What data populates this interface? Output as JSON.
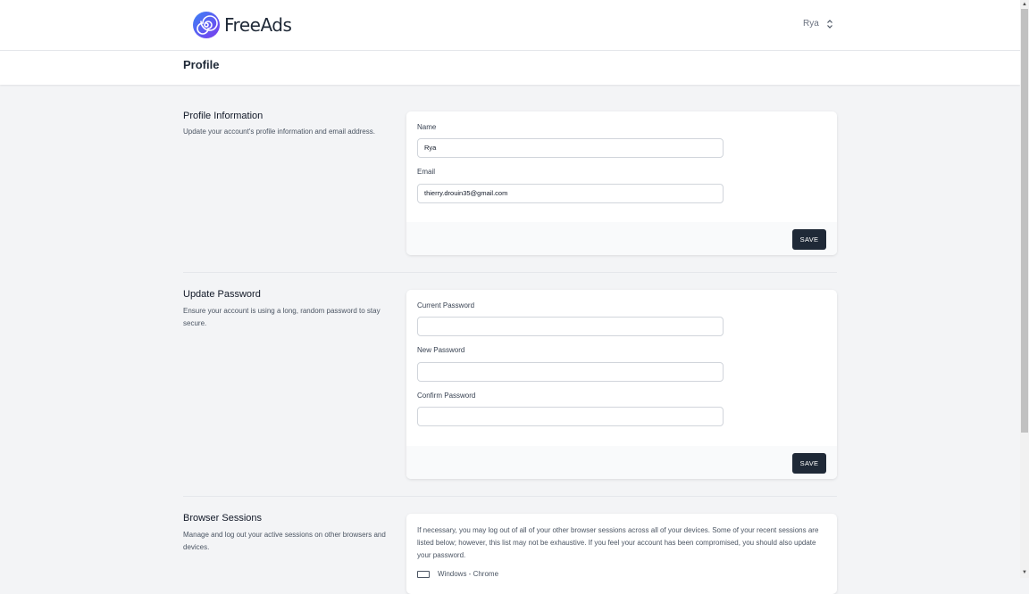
{
  "app": {
    "name": "FreeAds"
  },
  "user_menu": {
    "name": "Rya"
  },
  "page": {
    "title": "Profile"
  },
  "profile_info": {
    "title": "Profile Information",
    "description": "Update your account's profile information and email address.",
    "name_label": "Name",
    "name_value": "Rya",
    "email_label": "Email",
    "email_value": "thierry.drouin35@gmail.com",
    "save_label": "SAVE"
  },
  "update_password": {
    "title": "Update Password",
    "description": "Ensure your account is using a long, random password to stay secure.",
    "current_label": "Current Password",
    "current_value": "",
    "new_label": "New Password",
    "new_value": "",
    "confirm_label": "Confirm Password",
    "confirm_value": "",
    "save_label": "SAVE"
  },
  "browser_sessions": {
    "title": "Browser Sessions",
    "description": "Manage and log out your active sessions on other browsers and devices.",
    "info": "If necessary, you may log out of all of your other browser sessions across all of your devices. Some of your recent sessions are listed below; however, this list may not be exhaustive. If you feel your account has been compromised, you should also update your password.",
    "sessions": [
      {
        "label": "Windows - Chrome",
        "icon": "monitor-icon"
      }
    ]
  },
  "colors": {
    "background": "#f3f4f6",
    "button": "#1f2937",
    "logo_gradient": [
      "#2563eb",
      "#7c3aed"
    ]
  }
}
